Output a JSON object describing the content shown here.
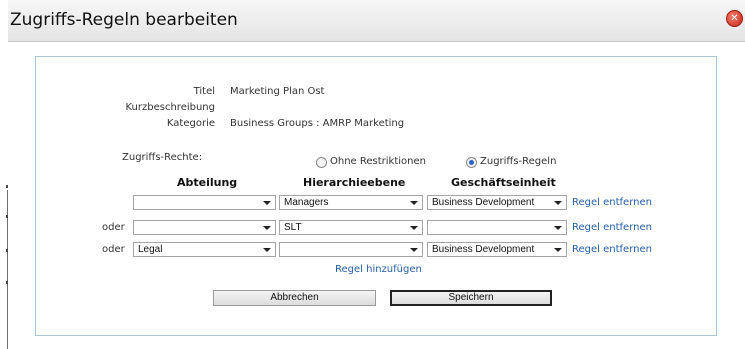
{
  "dialog": {
    "title": "Zugriffs-Regeln bearbeiten"
  },
  "fields": {
    "titel_label": "Titel",
    "titel_value": "Marketing Plan Ost",
    "kurz_label": "Kurzbeschreibung",
    "kurz_value": "",
    "kategorie_label": "Kategorie",
    "kategorie_value": "Business Groups : AMRP Marketing"
  },
  "rights": {
    "label": "Zugriffs-Rechte:",
    "option_none": "Ohne Restriktionen",
    "option_rules": "Zugriffs-Regeln",
    "selected": "Zugriffs-Regeln"
  },
  "columns": {
    "abteilung": "Abteilung",
    "hierarchie": "Hierarchieebene",
    "geschaeft": "Geschäftseinheit"
  },
  "rows": [
    {
      "prefix": "",
      "abteilung": "",
      "hierarchie": "Managers",
      "geschaeft": "Business Development",
      "remove": "Regel entfernen"
    },
    {
      "prefix": "oder",
      "abteilung": "",
      "hierarchie": "SLT",
      "geschaeft": "",
      "remove": "Regel entfernen"
    },
    {
      "prefix": "oder",
      "abteilung": "Legal",
      "hierarchie": "",
      "geschaeft": "Business Development",
      "remove": "Regel entfernen"
    }
  ],
  "add_rule": "Regel hinzufügen",
  "buttons": {
    "cancel": "Abbrechen",
    "save": "Speichern"
  },
  "icons": {
    "close": "close-icon"
  },
  "colors": {
    "link": "#2760a8",
    "panel_border": "#a9c6dc",
    "close": "#c8281a"
  }
}
